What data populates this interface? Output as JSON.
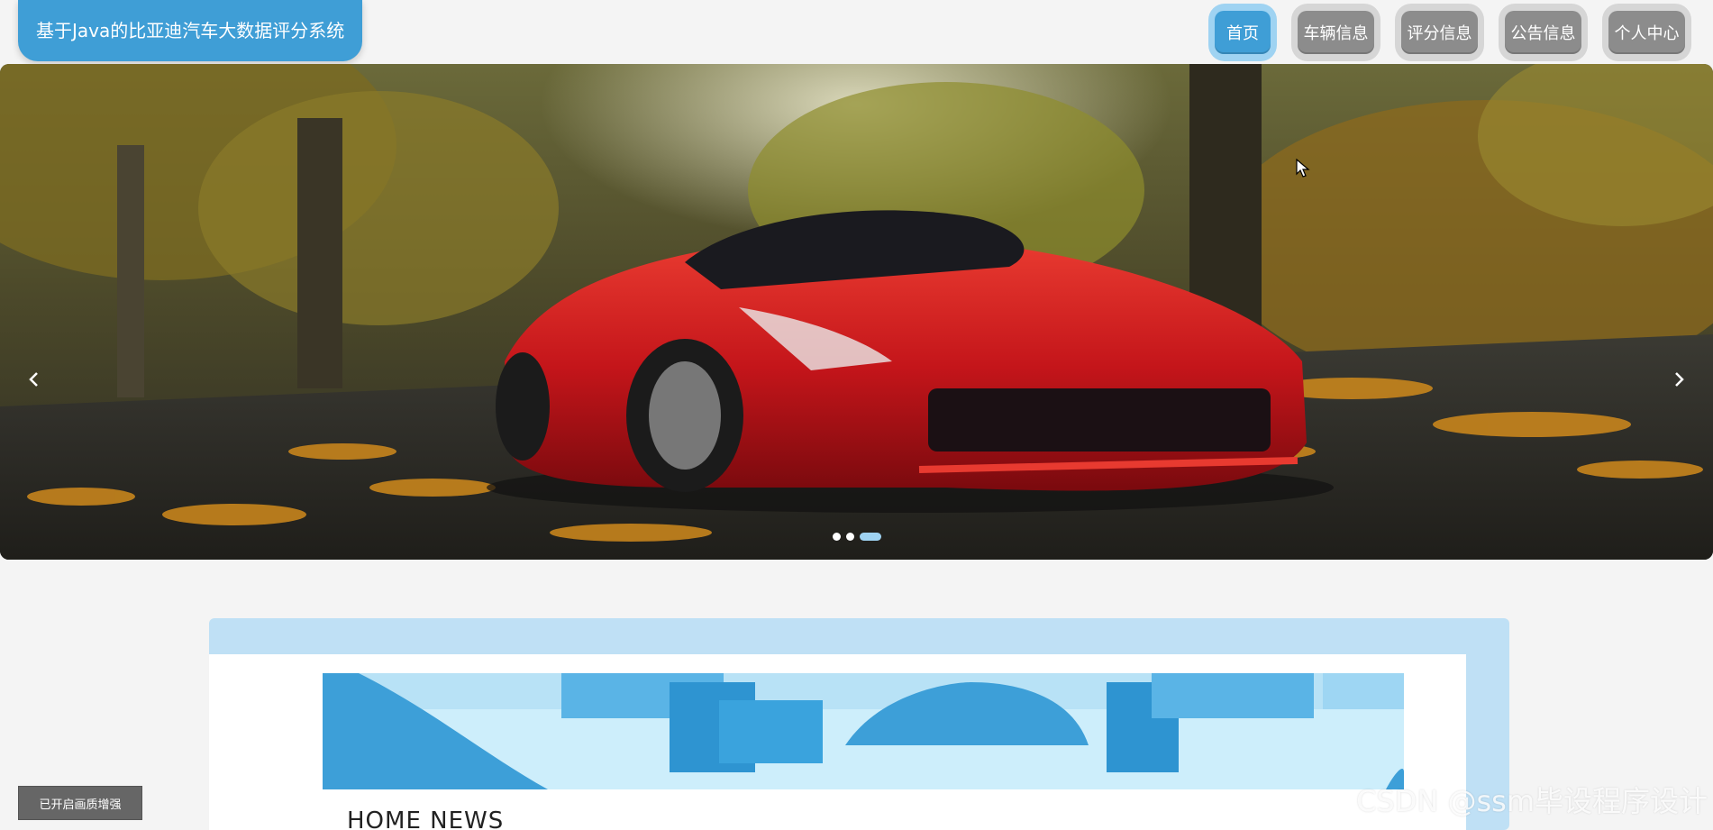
{
  "header": {
    "site_title": "基于Java的比亚迪汽车大数据评分系统",
    "nav": [
      {
        "label": "首页",
        "active": true
      },
      {
        "label": "车辆信息",
        "active": false
      },
      {
        "label": "评分信息",
        "active": false
      },
      {
        "label": "公告信息",
        "active": false
      },
      {
        "label": "个人中心",
        "active": false
      }
    ]
  },
  "carousel": {
    "image_subject": "red sports car on autumn leaf-covered road",
    "prev_icon": "chevron-left-icon",
    "next_icon": "chevron-right-icon",
    "slide_count": 3,
    "active_slide": 3
  },
  "news": {
    "section_title": "HOME NEWS"
  },
  "overlay": {
    "enhance_label": "已开启画质增强",
    "watermark": "CSDN @ssm毕设程序设计"
  },
  "colors": {
    "accent": "#3f9ed6",
    "accent_light": "#9fd3f2",
    "nav_inactive": "#8c8c8c"
  }
}
